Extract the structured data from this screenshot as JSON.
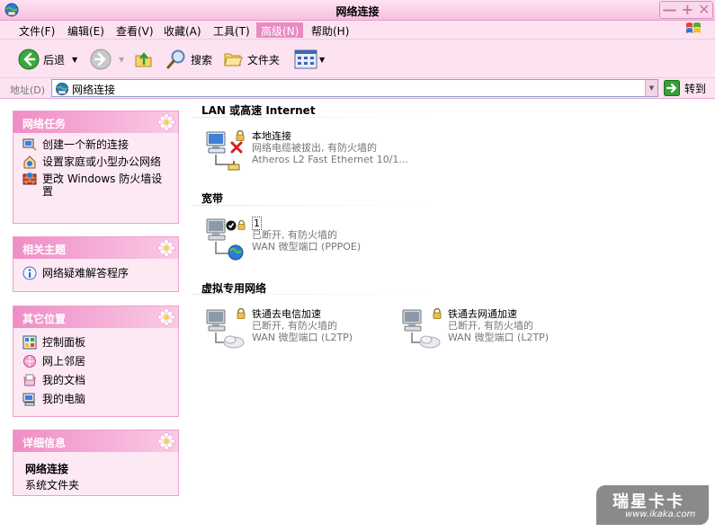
{
  "window": {
    "title": "网络连接",
    "controls": [
      "—",
      "+",
      "✕"
    ]
  },
  "menu": {
    "items": [
      "文件(F)",
      "编辑(E)",
      "查看(V)",
      "收藏(A)",
      "工具(T)",
      "高级(N)",
      "帮助(H)"
    ],
    "active_index": 5
  },
  "toolbar": {
    "back_label": "后退",
    "search_label": "搜索",
    "folders_label": "文件夹"
  },
  "address": {
    "label": "地址(D)",
    "value": "网络连接",
    "go_label": "转到"
  },
  "panels": {
    "network_tasks": {
      "title": "网络任务",
      "items": [
        "创建一个新的连接",
        "设置家庭或小型办公网络",
        "更改 Windows 防火墙设置"
      ]
    },
    "related_topics": {
      "title": "相关主题",
      "items": [
        "网络疑难解答程序"
      ]
    },
    "other_places": {
      "title": "其它位置",
      "items": [
        "控制面板",
        "网上邻居",
        "我的文档",
        "我的电脑"
      ]
    },
    "details": {
      "title": "详细信息",
      "name": "网络连接",
      "type": "系统文件夹"
    }
  },
  "groups": {
    "lan": {
      "title": "LAN 或高速 Internet",
      "items": [
        {
          "name": "本地连接",
          "status": "网络电缆被拔出, 有防火墙的",
          "device": "Atheros L2 Fast Ethernet 10/1..."
        }
      ]
    },
    "broadband": {
      "title": "宽带",
      "items": [
        {
          "name": "1",
          "status": "已断开, 有防火墙的",
          "device": "WAN 微型端口 (PPPOE)"
        }
      ]
    },
    "vpn": {
      "title": "虚拟专用网络",
      "items": [
        {
          "name": "铁通去电信加速",
          "status": "已断开, 有防火墙的",
          "device": "WAN 微型端口 (L2TP)"
        },
        {
          "name": "铁通去网通加速",
          "status": "已断开, 有防火墙的",
          "device": "WAN 微型端口 (L2TP)"
        }
      ]
    }
  },
  "watermark": {
    "line1": "瑞星卡卡",
    "line2": "www.ikaka.com"
  }
}
